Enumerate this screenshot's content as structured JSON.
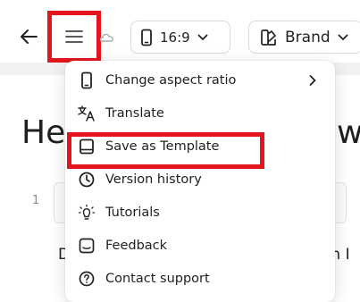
{
  "toolbar": {
    "back_icon": "arrow-left-icon",
    "menu_icon": "hamburger-menu-icon",
    "cloud_icon": "cloud-icon",
    "aspect_ratio": {
      "icon": "phone-icon",
      "label": "16:9"
    },
    "brand": {
      "icon": "brand-kit-icon",
      "label": "Brand"
    }
  },
  "background": {
    "heading_left": "He",
    "heading_right": "w",
    "line_number": "1",
    "text_left": "D",
    "text_right": "on I"
  },
  "menu": {
    "items": [
      {
        "label": "Change aspect ratio",
        "icon": "phone-icon",
        "has_submenu": true
      },
      {
        "label": "Translate",
        "icon": "translate-icon",
        "has_submenu": false
      },
      {
        "label": "Save as Template",
        "icon": "template-icon",
        "has_submenu": false,
        "highlighted": true
      },
      {
        "label": "Version history",
        "icon": "clock-icon",
        "has_submenu": false
      },
      {
        "label": "Tutorials",
        "icon": "lightbulb-icon",
        "has_submenu": false
      },
      {
        "label": "Feedback",
        "icon": "feedback-icon",
        "has_submenu": false
      },
      {
        "label": "Contact support",
        "icon": "question-circle-icon",
        "has_submenu": false
      }
    ]
  },
  "colors": {
    "highlight": "#e3161e",
    "text": "#1f1f1f",
    "border": "#d9d9d9"
  }
}
